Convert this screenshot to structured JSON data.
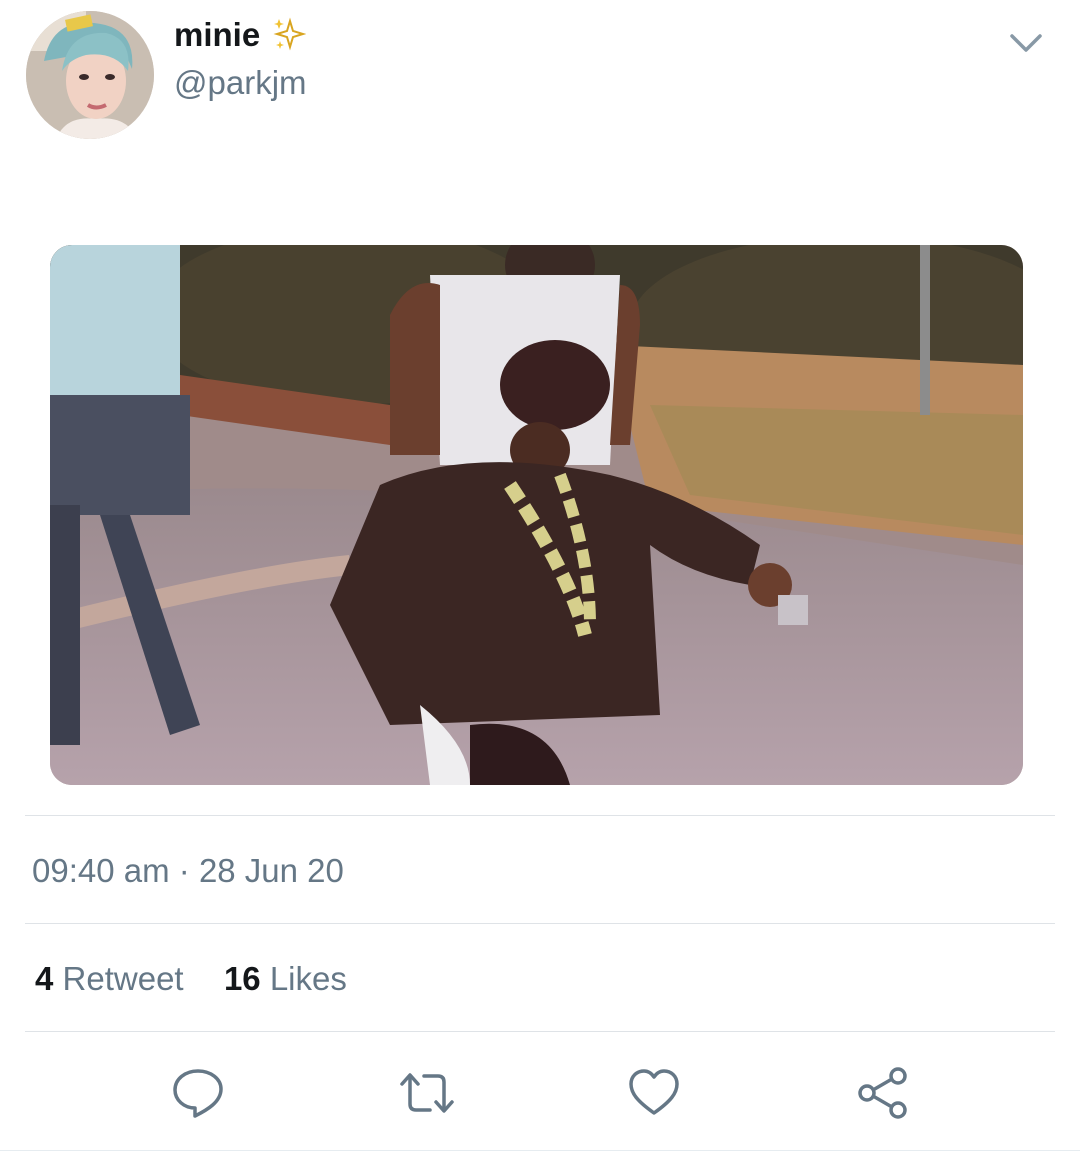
{
  "user": {
    "display_name": "minie",
    "handle": "@parkjm",
    "name_emoji": "sparkles-icon"
  },
  "tweet": {
    "time": "09:40 am",
    "separator": "·",
    "date": "28 Jun 20",
    "retweet_count": "4",
    "retweet_label": "Retweet",
    "likes_count": "16",
    "likes_label": "Likes"
  },
  "actions": [
    "reply-icon",
    "retweet-icon",
    "like-icon",
    "share-icon"
  ],
  "colors": {
    "text_primary": "#14171a",
    "text_secondary": "#657786",
    "divider": "#dfe3e7"
  }
}
